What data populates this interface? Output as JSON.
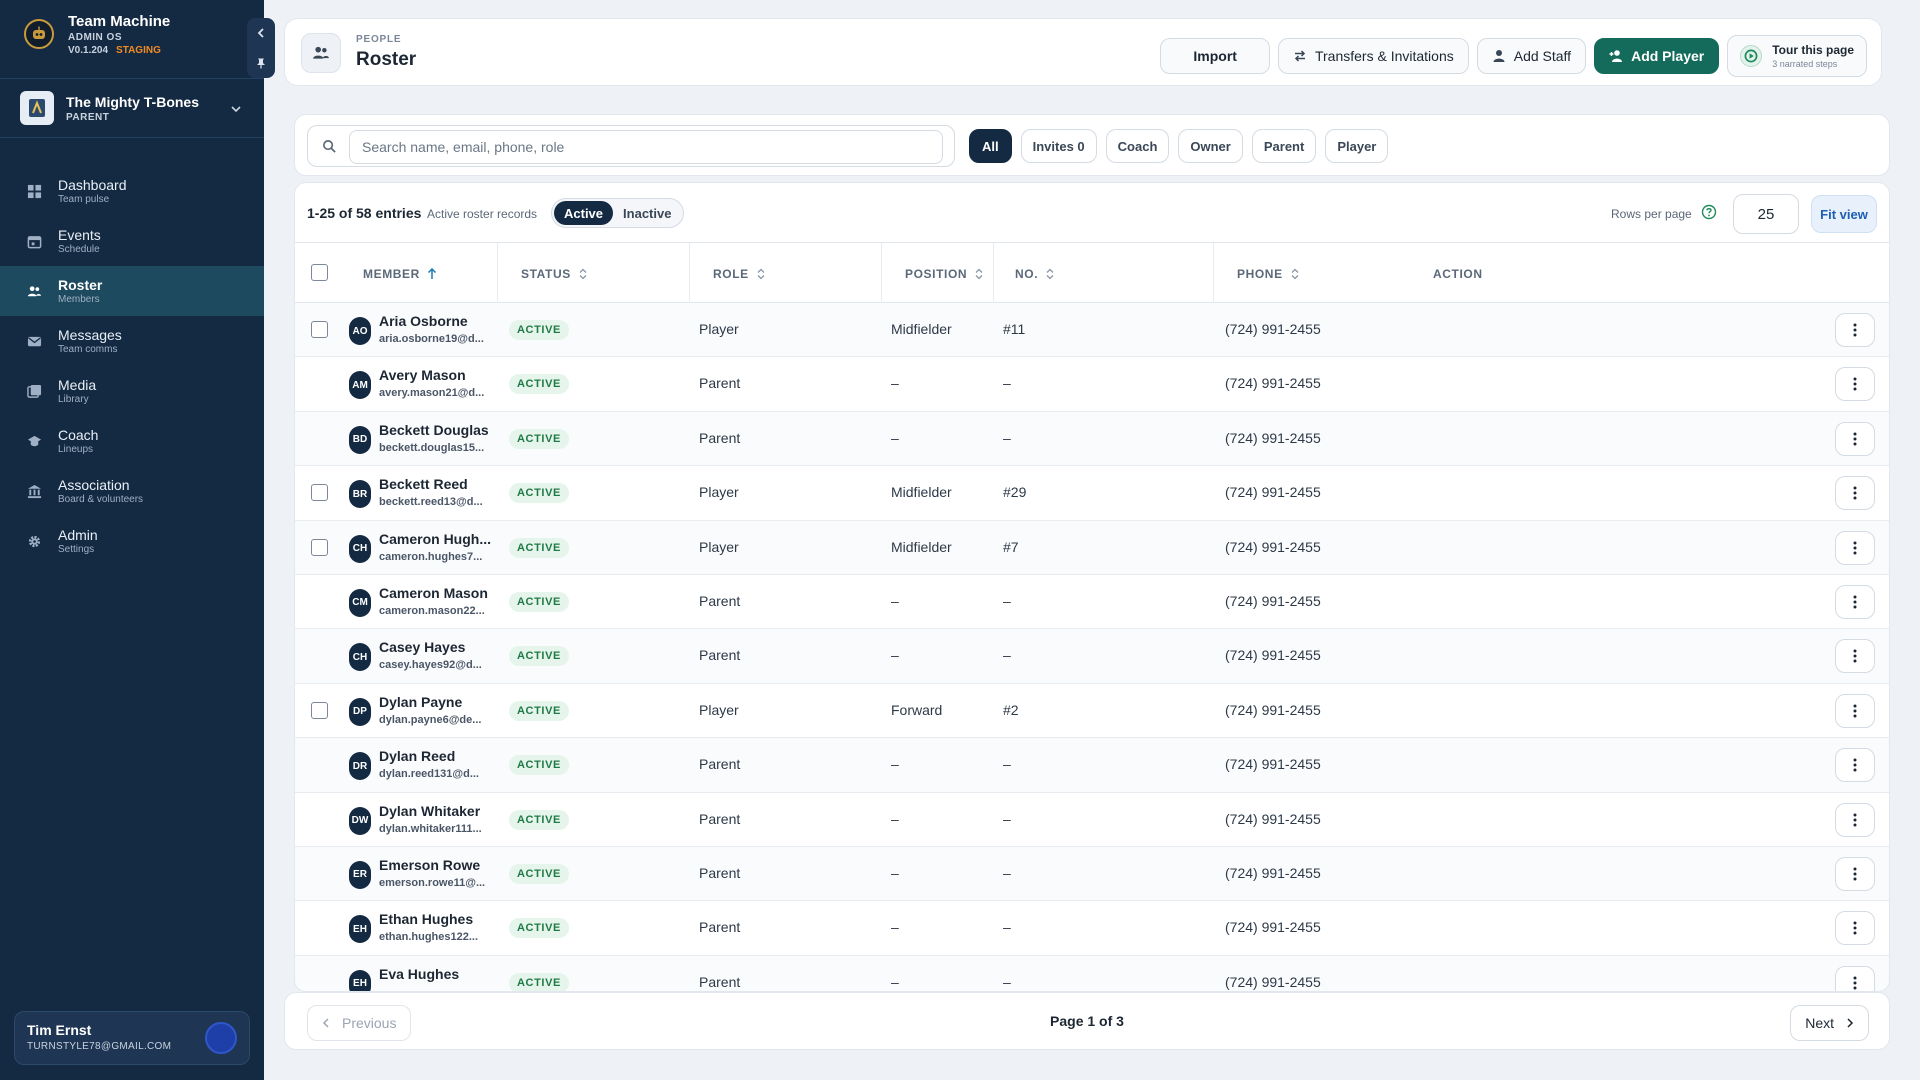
{
  "app": {
    "name": "Team Machine",
    "subtitle": "ADMIN OS",
    "version": "V0.1.204",
    "env": "STAGING"
  },
  "team": {
    "name": "The Mighty T-Bones",
    "role": "PARENT"
  },
  "nav": [
    {
      "label": "Dashboard",
      "sub": "Team pulse",
      "icon": "dashboard-icon",
      "active": false
    },
    {
      "label": "Events",
      "sub": "Schedule",
      "icon": "calendar-icon",
      "active": false
    },
    {
      "label": "Roster",
      "sub": "Members",
      "icon": "people-icon",
      "active": true
    },
    {
      "label": "Messages",
      "sub": "Team comms",
      "icon": "mail-icon",
      "active": false
    },
    {
      "label": "Media",
      "sub": "Library",
      "icon": "media-icon",
      "active": false
    },
    {
      "label": "Coach",
      "sub": "Lineups",
      "icon": "coach-icon",
      "active": false
    },
    {
      "label": "Association",
      "sub": "Board & volunteers",
      "icon": "bank-icon",
      "active": false
    },
    {
      "label": "Admin",
      "sub": "Settings",
      "icon": "gear-icon",
      "active": false
    }
  ],
  "user": {
    "name": "Tim Ernst",
    "email": "TURNSTYLE78@GMAIL.COM"
  },
  "header": {
    "eyebrow": "PEOPLE",
    "title": "Roster",
    "import_label": "Import",
    "transfers_label": "Transfers & Invitations",
    "add_staff_label": "Add Staff",
    "add_player_label": "Add Player",
    "tour_title": "Tour this page",
    "tour_sub": "3 narrated steps"
  },
  "search": {
    "placeholder": "Search name, email, phone, role"
  },
  "filters": [
    "All",
    "Invites 0",
    "Coach",
    "Owner",
    "Parent",
    "Player"
  ],
  "toolbar": {
    "entries": "1-25 of 58 entries",
    "entries_sub": "Active roster records",
    "seg_active": "Active",
    "seg_inactive": "Inactive",
    "rows_per_page_label": "Rows per page",
    "rows_per_page_value": "25",
    "fit_view_label": "Fit view"
  },
  "columns": {
    "member": "MEMBER",
    "status": "STATUS",
    "role": "ROLE",
    "position": "POSITION",
    "no": "NO.",
    "phone": "PHONE",
    "action": "ACTION"
  },
  "rows": [
    {
      "initials": "AO",
      "name": "Aria Osborne",
      "email": "aria.osborne19@d...",
      "status": "ACTIVE",
      "role": "Player",
      "position": "Midfielder",
      "no": "#11",
      "phone": "(724) 991-2455",
      "checkbox": true
    },
    {
      "initials": "AM",
      "name": "Avery Mason",
      "email": "avery.mason21@d...",
      "status": "ACTIVE",
      "role": "Parent",
      "position": "–",
      "no": "–",
      "phone": "(724) 991-2455",
      "checkbox": false
    },
    {
      "initials": "BD",
      "name": "Beckett Douglas",
      "email": "beckett.douglas15...",
      "status": "ACTIVE",
      "role": "Parent",
      "position": "–",
      "no": "–",
      "phone": "(724) 991-2455",
      "checkbox": false
    },
    {
      "initials": "BR",
      "name": "Beckett Reed",
      "email": "beckett.reed13@d...",
      "status": "ACTIVE",
      "role": "Player",
      "position": "Midfielder",
      "no": "#29",
      "phone": "(724) 991-2455",
      "checkbox": true
    },
    {
      "initials": "CH",
      "name": "Cameron Hugh...",
      "email": "cameron.hughes7...",
      "status": "ACTIVE",
      "role": "Player",
      "position": "Midfielder",
      "no": "#7",
      "phone": "(724) 991-2455",
      "checkbox": true
    },
    {
      "initials": "CM",
      "name": "Cameron Mason",
      "email": "cameron.mason22...",
      "status": "ACTIVE",
      "role": "Parent",
      "position": "–",
      "no": "–",
      "phone": "(724) 991-2455",
      "checkbox": false
    },
    {
      "initials": "CH",
      "name": "Casey Hayes",
      "email": "casey.hayes92@d...",
      "status": "ACTIVE",
      "role": "Parent",
      "position": "–",
      "no": "–",
      "phone": "(724) 991-2455",
      "checkbox": false
    },
    {
      "initials": "DP",
      "name": "Dylan Payne",
      "email": "dylan.payne6@de...",
      "status": "ACTIVE",
      "role": "Player",
      "position": "Forward",
      "no": "#2",
      "phone": "(724) 991-2455",
      "checkbox": true
    },
    {
      "initials": "DR",
      "name": "Dylan Reed",
      "email": "dylan.reed131@d...",
      "status": "ACTIVE",
      "role": "Parent",
      "position": "–",
      "no": "–",
      "phone": "(724) 991-2455",
      "checkbox": false
    },
    {
      "initials": "DW",
      "name": "Dylan Whitaker",
      "email": "dylan.whitaker111...",
      "status": "ACTIVE",
      "role": "Parent",
      "position": "–",
      "no": "–",
      "phone": "(724) 991-2455",
      "checkbox": false
    },
    {
      "initials": "ER",
      "name": "Emerson Rowe",
      "email": "emerson.rowe11@...",
      "status": "ACTIVE",
      "role": "Parent",
      "position": "–",
      "no": "–",
      "phone": "(724) 991-2455",
      "checkbox": false
    },
    {
      "initials": "EH",
      "name": "Ethan Hughes",
      "email": "ethan.hughes122...",
      "status": "ACTIVE",
      "role": "Parent",
      "position": "–",
      "no": "–",
      "phone": "(724) 991-2455",
      "checkbox": false
    },
    {
      "initials": "EH",
      "name": "Eva Hughes",
      "email": "",
      "status": "ACTIVE",
      "role": "Parent",
      "position": "–",
      "no": "–",
      "phone": "(724) 991-2455",
      "checkbox": false
    }
  ],
  "pagination": {
    "prev_label": "Previous",
    "info": "Page 1 of 3",
    "next_label": "Next"
  },
  "colors": {
    "sidebar_bg": "#142a42",
    "primary": "#146b5b",
    "active_status_bg": "#e6f5ec",
    "active_status_text": "#1f7a45",
    "staging": "#f08a24"
  }
}
